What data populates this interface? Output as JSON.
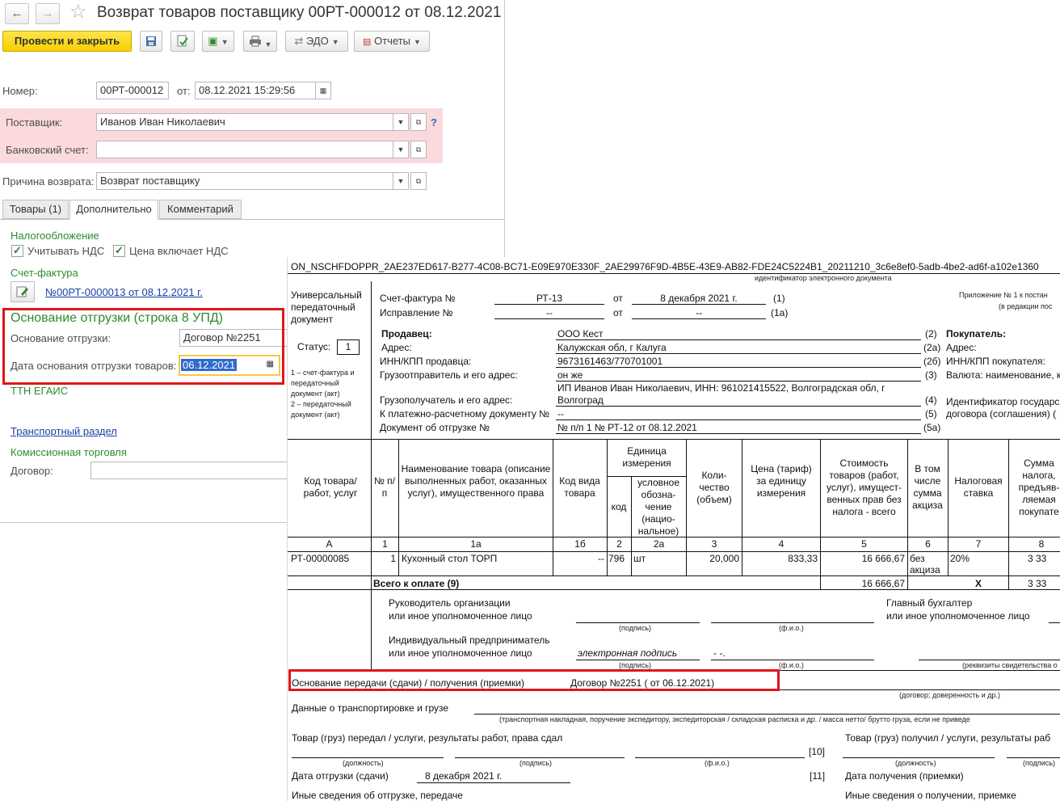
{
  "window": {
    "title": "Возврат товаров поставщику 00РТ-000012 от 08.12.2021"
  },
  "toolbar": {
    "post_close": "Провести и закрыть",
    "edo": "ЭДО",
    "reports": "Отчеты"
  },
  "header": {
    "number_label": "Номер:",
    "number_value": "00РТ-000012",
    "date_label": "от:",
    "date_value": "08.12.2021 15:29:56",
    "supplier_label": "Поставщик:",
    "supplier_value": "Иванов Иван Николаевич",
    "help": "?",
    "bank_label": "Банковский счет:",
    "bank_value": "",
    "reason_label": "Причина возврата:",
    "reason_value": "Возврат поставщику"
  },
  "tabs": [
    {
      "label": "Товары (1)"
    },
    {
      "label": "Дополнительно"
    },
    {
      "label": "Комментарий"
    }
  ],
  "additional": {
    "tax_title": "Налогообложение",
    "vat_label": "Учитывать НДС",
    "price_vat_label": "Цена включает НДС",
    "invoice_title": "Счет-фактура",
    "invoice_link": "№00РТ-0000013 от 08.12.2021 г.",
    "basis_title": "Основание отгрузки (строка 8 УПД)",
    "basis_label": "Основание отгрузки:",
    "basis_value": "Договор №2251",
    "basis_date_label": "Дата основания отгрузки товаров:",
    "basis_date_value": "06.12.2021",
    "egais": "ТТН ЕГАИС",
    "transport_link": "Транспортный раздел",
    "commission_title": "Комиссионная торговля",
    "contract_label": "Договор:"
  },
  "upd": {
    "doc_id": "ON_NSCHFDOPPR_2AE237ED617-B277-4C08-BC71-E09E970E330F_2AE29976F9D-4B5E-43E9-AB82-FDE24C5224B1_20211210_3c6e8ef0-5adb-4be2-ad6f-a102e1360",
    "doc_id_caption": "идентификатор электронного документа",
    "upd_title_1": "Универсальный",
    "upd_title_2": "передаточный",
    "upd_title_3": "документ",
    "status_label": "Статус:",
    "status_value": "1",
    "status_note_1": "1 – счет-фактура и",
    "status_note_2": "передаточный",
    "status_note_3": "документ (акт)",
    "status_note_4": "2 – передаточный",
    "status_note_5": "документ (акт)",
    "invoice_label": "Счет-фактура №",
    "invoice_no": "РТ-13",
    "ot": "от",
    "invoice_date": "8 декабря 2021 г.",
    "n1": "(1)",
    "correction_label": "Исправление №",
    "dash": "--",
    "n1a": "(1а)",
    "appendix_1": "Приложение № 1 к постан",
    "appendix_2": "(в редакции пос",
    "seller_label": "Продавец:",
    "seller_value": "ООО Кест",
    "n2": "(2)",
    "address_label": "Адрес:",
    "address_value": "Калужская обл, г Калуга",
    "n2a": "(2а)",
    "inn_label": "ИНН/КПП продавца:",
    "inn_value": "9673161463/770701001",
    "n2b": "(2б)",
    "shipper_label": "Грузоотправитель и его адрес:",
    "shipper_value": "он же",
    "n3": "(3)",
    "consignee_label": "Грузополучатель и его адрес:",
    "consignee_value_1": "ИП Иванов Иван Николаевич, ИНН: 961021415522, Волгоградская обл, г",
    "consignee_value_2": "Волгоград",
    "n4": "(4)",
    "payment_label": "К платежно-расчетному документу №",
    "payment_value": "--",
    "n5": "(5)",
    "shipdoc_label": "Документ об отгрузке №",
    "shipdoc_value": "№ п/п 1 № РТ-12 от 08.12.2021",
    "n5a": "(5а)",
    "buyer_label": "Покупатель:",
    "buyer_address": "Адрес:",
    "buyer_inn": "ИНН/КПП покупателя:",
    "buyer_currency": "Валюта: наименование, к",
    "buyer_gov_1": "Идентификатор государс",
    "buyer_gov_2": "договора (соглашения) (",
    "col_code": "Код товара/ работ, услуг",
    "col_num": "№ п/п",
    "col_name": "Наименование товара (описание выполненных работ, оказанных услуг), имущественного права",
    "col_kind": "Код вида товара",
    "col_unit": "Единица измерения",
    "col_unit_code": "код",
    "col_unit_name": "условное обозна-чение (нацио-нальное)",
    "col_qty": "Коли-чество (объем)",
    "col_price": "Цена (тариф) за единицу измерения",
    "col_cost": "Стоимость товаров (работ, услуг), имущест-венных прав без налога - всего",
    "col_excise": "В том числе сумма акциза",
    "col_rate": "Налоговая ставка",
    "col_tax": "Сумма налога, предъяв-ляемая покупате",
    "idx": [
      "А",
      "1",
      "1а",
      "1б",
      "2",
      "2а",
      "3",
      "4",
      "5",
      "6",
      "7",
      "8"
    ],
    "row_code": "РТ-00000085",
    "row_num": "1",
    "row_name": "Кухонный стол ТОРП",
    "row_kind": "--",
    "row_unit_code": "796",
    "row_unit_name": "шт",
    "row_qty": "20,000",
    "row_price": "833,33",
    "row_cost": "16 666,67",
    "row_excise_1": "без",
    "row_excise_2": "акциза",
    "row_rate": "20%",
    "row_tax": "3 33",
    "total_label": "Всего к оплате (9)",
    "total_cost": "16 666,67",
    "total_x": "Х",
    "total_tax": "3 33",
    "head_label_1": "Руководитель организации",
    "head_label_2": "или иное уполномоченное лицо",
    "sign_caption": "(подпись)",
    "fio_caption": "(ф.и.о.)",
    "chief_acc_1": "Главный бухгалтер",
    "chief_acc_2": "или иное уполномоченное лицо",
    "ip_label_1": "Индивидуальный предприниматель",
    "ip_label_2": "или иное уполномоченное лицо",
    "esign": "электронная подпись",
    "ip_fio": "- -.",
    "cert_caption": "(реквизиты свидетельства о",
    "basis_label": "Основание передачи (сдачи) / получения (приемки)",
    "basis_value": "Договор №2251 ( от 06.12.2021)",
    "basis_caption": "(договор; доверенность и др.)",
    "transport_label": "Данные о транспортировке и грузе",
    "transport_caption": "(транспортная накладная, поручение экспедитору, экспедиторская / складская расписка и др. / масса нетто/ брутто груза, если не приведе",
    "handed_label": "Товар (груз) передал / услуги, результаты работ, права сдал",
    "received_label": "Товар (груз) получил / услуги, результаты раб",
    "position_caption": "(должность)",
    "n10": "[10]",
    "ship_date_label": "Дата отгрузки (сдачи)",
    "ship_date_value": "8 декабря 2021 г.",
    "n11": "[11]",
    "receive_date_label": "Дата получения (приемки)",
    "other_ship": "Иные сведения об отгрузке, передаче",
    "other_receive": "Иные сведения о получении, приемке"
  },
  "colors": {
    "highlight_red": "#e0161b",
    "primary_yellow": "#f7d000",
    "required_pink": "#fadadd",
    "group_green": "#2e8b2e",
    "link_blue": "#1a3fa8"
  }
}
